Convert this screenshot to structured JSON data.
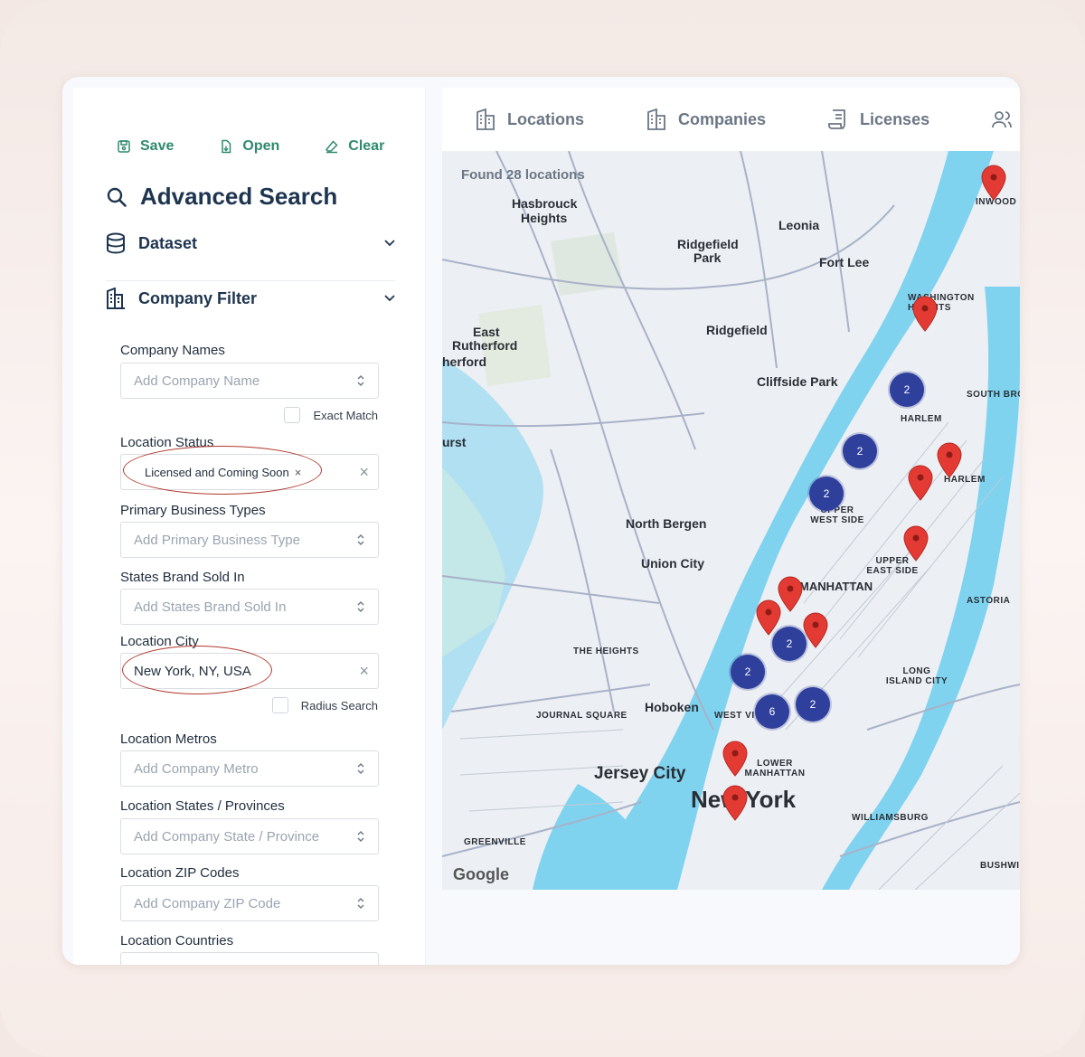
{
  "toolbar": {
    "save": "Save",
    "open": "Open",
    "clear": "Clear"
  },
  "title": "Advanced Search",
  "sections": {
    "dataset": "Dataset",
    "company_filter": "Company Filter"
  },
  "fields": {
    "company_names": {
      "label": "Company Names",
      "placeholder": "Add Company Name",
      "exact_match": "Exact Match"
    },
    "location_status": {
      "label": "Location Status",
      "tag": "Licensed and Coming Soon"
    },
    "primary_business_types": {
      "label": "Primary Business Types",
      "placeholder": "Add Primary Business Type"
    },
    "states_brand_sold_in": {
      "label": "States Brand Sold In",
      "placeholder": "Add States Brand Sold In"
    },
    "location_city": {
      "label": "Location City",
      "value": "New York, NY, USA",
      "radius_search": "Radius Search"
    },
    "location_metros": {
      "label": "Location Metros",
      "placeholder": "Add Company Metro"
    },
    "location_states": {
      "label": "Location States / Provinces",
      "placeholder": "Add Company State / Province"
    },
    "location_zip": {
      "label": "Location ZIP Codes",
      "placeholder": "Add Company ZIP Code"
    },
    "location_countries": {
      "label": "Location Countries"
    }
  },
  "tabs": [
    "Locations",
    "Companies",
    "Licenses"
  ],
  "map": {
    "found_text": "Found 28 locations",
    "attribution": "Google",
    "labels": {
      "hasbrouck": "Hasbrouck",
      "heights": "Heights",
      "leonia": "Leonia",
      "ridgefield_park_1": "Ridgefield",
      "ridgefield_park_2": "Park",
      "fort_lee": "Fort Lee",
      "inwood": "INWOOD",
      "washington_heights": "WASHINGTON HEIGHTS",
      "east": "East",
      "rutherford": "Rutherford",
      "ridgefield": "Ridgefield",
      "rutherford2": "herford",
      "cliffside": "Cliffside Park",
      "harlem": "HARLEM",
      "south_bronx": "SOUTH BRO",
      "east_harlem": "HARLEM",
      "upper_west": "UPPER WEST SIDE",
      "upper_east": "UPPER EAST SIDE",
      "north_bergen": "North Bergen",
      "union_city": "Union City",
      "manhattan": "MANHATTAN",
      "astoria": "ASTORIA",
      "the_heights": "THE HEIGHTS",
      "hoboken": "Hoboken",
      "journal_square": "JOURNAL SQUARE",
      "long_island_city": "LONG ISLAND CITY",
      "jersey_city": "Jersey City",
      "lower_manhattan": "LOWER MANHATTAN",
      "new_york": "New York",
      "williamsburg": "WILLIAMSBURG",
      "greenville": "GREENVILLE",
      "bushwick": "BUSHWI",
      "hurst": "urst",
      "west_village": "WEST VI"
    },
    "clusters": [
      "2",
      "2",
      "2",
      "2",
      "2",
      "6",
      "2"
    ]
  }
}
